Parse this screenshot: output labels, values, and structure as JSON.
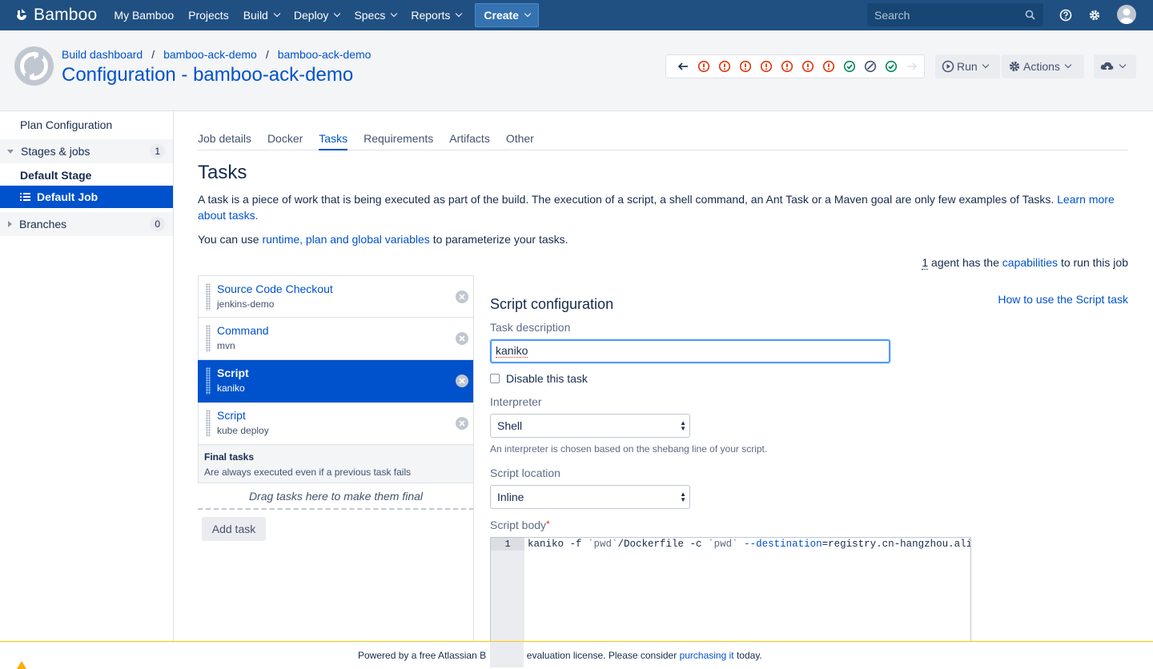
{
  "topnav": {
    "brand": "Bamboo",
    "items": [
      {
        "label": "My Bamboo",
        "dropdown": false
      },
      {
        "label": "Projects",
        "dropdown": false
      },
      {
        "label": "Build",
        "dropdown": true
      },
      {
        "label": "Deploy",
        "dropdown": true
      },
      {
        "label": "Specs",
        "dropdown": true
      },
      {
        "label": "Reports",
        "dropdown": true
      }
    ],
    "create_label": "Create",
    "search_placeholder": "Search",
    "colors": {
      "bar": "#205081",
      "create": "#3572b0"
    }
  },
  "header": {
    "breadcrumbs": [
      "Build dashboard",
      "bamboo-ack-demo",
      "bamboo-ack-demo"
    ],
    "title": "Configuration - bamboo-ack-demo",
    "history": [
      "back",
      "failed",
      "failed",
      "failed",
      "failed",
      "failed",
      "failed",
      "failed",
      "success",
      "never-built",
      "success",
      "forward"
    ],
    "run_label": "Run",
    "actions_label": "Actions"
  },
  "sidebar": {
    "plan_configuration": "Plan Configuration",
    "stages_jobs": {
      "label": "Stages & jobs",
      "count": "1"
    },
    "stage": "Default Stage",
    "job": "Default Job",
    "branches": {
      "label": "Branches",
      "count": "0"
    }
  },
  "tabs": [
    "Job details",
    "Docker",
    "Tasks",
    "Requirements",
    "Artifacts",
    "Other"
  ],
  "active_tab": "Tasks",
  "main": {
    "heading": "Tasks",
    "intro": "A task is a piece of work that is being executed as part of the build. The execution of a script, a shell command, an Ant Task or a Maven goal are only few examples of Tasks.",
    "intro_link": "Learn more about tasks.",
    "vars_prefix": "You can use",
    "vars_link": "runtime, plan and global variables",
    "vars_suffix": "to parameterize your tasks.",
    "agent_count": "1",
    "agent_mid": "agent has the",
    "agent_link": "capabilities",
    "agent_suffix": "to run this job"
  },
  "tasks": [
    {
      "name": "Source Code Checkout",
      "desc": "jenkins-demo",
      "selected": false
    },
    {
      "name": "Command",
      "desc": "mvn",
      "selected": false
    },
    {
      "name": "Script",
      "desc": "kaniko",
      "selected": true
    },
    {
      "name": "Script",
      "desc": "kube deploy",
      "selected": false
    }
  ],
  "final_tasks": {
    "title": "Final tasks",
    "subtitle": "Are always executed even if a previous task fails",
    "drop_hint": "Drag tasks here to make them final"
  },
  "add_task_label": "Add task",
  "config": {
    "title": "Script configuration",
    "help_link": "How to use the Script task",
    "task_description_label": "Task description",
    "task_description_value": "kaniko",
    "disable_label": "Disable this task",
    "interpreter_label": "Interpreter",
    "interpreter_value": "Shell",
    "interpreter_note": "An interpreter is chosen based on the shebang line of your script.",
    "location_label": "Script location",
    "location_value": "Inline",
    "body_label": "Script body",
    "required_mark": "*",
    "line_number": "1",
    "code_line": {
      "a": "kaniko -f ",
      "b": "`pwd`",
      "c": "/Dockerfile -c ",
      "d": "`pwd`",
      "e": " ",
      "f": "--destination",
      "g": "=registry.cn-hangzhou.aliyun"
    }
  },
  "footer": {
    "prefix": "Powered by a free Atlassian B",
    "mid": "evaluation license. Please consider",
    "link": "purchasing it",
    "suffix": "today."
  }
}
